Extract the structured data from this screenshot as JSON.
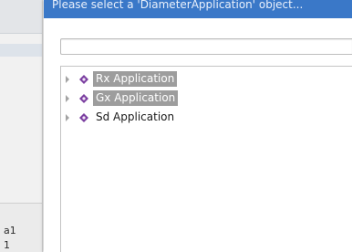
{
  "background_app": {
    "row_labels": [
      "a1",
      "1"
    ]
  },
  "dialog": {
    "title": "Please select a 'DiameterApplication' object...",
    "filter": {
      "value": "",
      "placeholder": ""
    },
    "tree": {
      "items": [
        {
          "label": "Rx Application",
          "selected": true,
          "expanded": false,
          "icon": "diamond-node-icon"
        },
        {
          "label": "Gx Application",
          "selected": true,
          "expanded": false,
          "icon": "diamond-node-icon"
        },
        {
          "label": "Sd Application",
          "selected": false,
          "expanded": false,
          "icon": "diamond-node-icon"
        }
      ]
    }
  },
  "colors": {
    "titlebar": "#3a78c8",
    "selection": "#9d9d9d",
    "node_icon": "#7b3fa0"
  }
}
